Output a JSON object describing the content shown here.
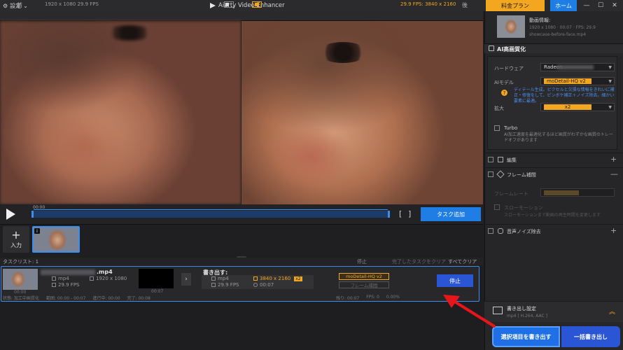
{
  "titlebar": {
    "settings_label": "設定",
    "app_title": "Aiarty Video Enhancer",
    "plan_label": "料金プラン",
    "home_label": "ホーム",
    "minimize": "—",
    "maximize": "☐",
    "close": "✕"
  },
  "infobar": {
    "before_label": "前",
    "left_res": "1920 x 1080  29.9 FPS",
    "right_res": "29.9 FPS: 3840 x 2160",
    "after_label": "後"
  },
  "playback": {
    "time_start": "00:00",
    "bracket_left": "[",
    "bracket_right": "]",
    "add_task_label": "タスク追加"
  },
  "strip": {
    "input_label": "入力"
  },
  "tasklist": {
    "label": "タスクリスト: 1",
    "stop": "停止",
    "clear_done": "完了したタスクをクリア",
    "clear_all": "すべてクリア"
  },
  "task": {
    "filename_suffix": ".mp4",
    "time0": "00:00",
    "src_fmt": "mp4",
    "src_res": "1920 x 1080",
    "src_fps": "29.9 FPS",
    "time1": "00:07",
    "chevron": "›",
    "export_label": "書き出す:",
    "out_fmt": "mp4",
    "out_res": "3840 x 2160",
    "out_scale": "x2",
    "out_fps": "29.9 FPS",
    "out_dur": "00:07",
    "model_tag": "moDetail-HQ  v2",
    "frame_tag": "フレーム補間",
    "stop_label": "停止",
    "status_state": "状態: 加工中画質化",
    "status_range": "範囲: 00:00 - 00:07",
    "status_elapsed": "進行中: 00:00",
    "status_done": "完了: 00:08",
    "status_remaining": "残り: 00:07",
    "status_fps": "FPS: 0",
    "status_pct": "0.00%"
  },
  "rpanel": {
    "info_title": "動画情報:",
    "info_meta": "1920 x 1080 · 00:07 · FPS: 29.9",
    "info_file": "showcase-before-face.mp4",
    "ai_title": "AI高画質化",
    "hw_label": "ハードウェア",
    "hw_value": "Radeon",
    "model_label": "AIモデル",
    "model_value": "moDetail-HQ  v2",
    "model_desc": "ディテール生成。ピクセルと欠損な情報をきれいに補正・修復をして、ピンボケ補正＋ノイズ除去。細かい要素に最適。",
    "scale_label": "拡大",
    "scale_value": "x2",
    "turbo_label": "Turbo",
    "turbo_desc": "AI加工速度を最適化するほど画質がわずかな画質のトレードオフがあります",
    "edit_label": "編集",
    "frame_label": "フレーム補間",
    "framerate_label": "フレームレート",
    "slowmo_label": "スローモーション",
    "slowmo_desc": "スローモーションまで動画の再生時間を変更します",
    "noise_label": "音声ノイズ除去",
    "export_title": "書き出し設定",
    "export_sub": "mp4 [ H.264, AAC ]",
    "export_selected": "選択項目を書き出す",
    "export_all": "一括書き出し"
  },
  "colors": {
    "accent_orange": "#f3a61f",
    "accent_blue": "#1f7de6",
    "callout_red": "#e8161b"
  }
}
